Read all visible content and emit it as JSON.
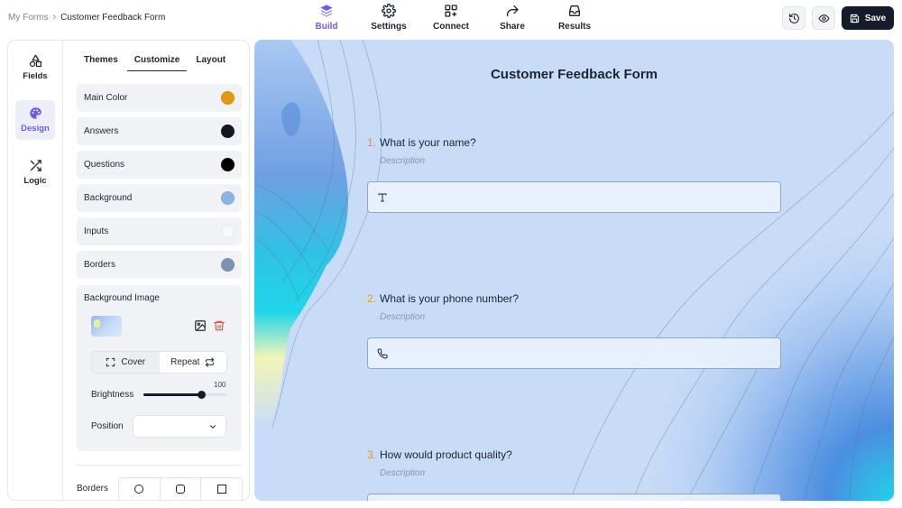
{
  "breadcrumb": {
    "root": "My Forms",
    "separator": "›",
    "current": "Customer Feedback Form"
  },
  "nav": [
    {
      "label": "Build",
      "icon": "layers-icon",
      "active": true
    },
    {
      "label": "Settings",
      "icon": "gear-icon",
      "active": false
    },
    {
      "label": "Connect",
      "icon": "integrations-icon",
      "active": false
    },
    {
      "label": "Share",
      "icon": "share-arrow-icon",
      "active": false
    },
    {
      "label": "Results",
      "icon": "inbox-icon",
      "active": false
    }
  ],
  "actions": {
    "save_label": "Save"
  },
  "rail": [
    {
      "label": "Fields",
      "icon": "shapes-icon",
      "active": false
    },
    {
      "label": "Design",
      "icon": "palette-icon",
      "active": true
    },
    {
      "label": "Logic",
      "icon": "shuffle-icon",
      "active": false
    }
  ],
  "tabs": [
    {
      "label": "Themes",
      "active": false
    },
    {
      "label": "Customize",
      "active": true
    },
    {
      "label": "Layout",
      "active": false
    }
  ],
  "colors": [
    {
      "label": "Main Color",
      "value": "#E39A0E"
    },
    {
      "label": "Answers",
      "value": "#151821"
    },
    {
      "label": "Questions",
      "value": "#000000"
    },
    {
      "label": "Background",
      "value": "#8DB3E6"
    },
    {
      "label": "Inputs",
      "value": "#F7F8FA"
    },
    {
      "label": "Borders",
      "value": "#7E93B4"
    }
  ],
  "background_image": {
    "title": "Background Image",
    "fit_options": [
      {
        "label": "Cover",
        "icon": "expand-icon",
        "selected": true
      },
      {
        "label": "Repeat",
        "icon": "repeat-icon",
        "selected": false
      }
    ],
    "brightness_label": "Brightness",
    "brightness_value": "100",
    "brightness_fraction": 0.7,
    "position_label": "Position",
    "position_value": ""
  },
  "borders": {
    "label": "Borders",
    "options": [
      "circle-icon",
      "rounded-square-icon",
      "square-icon"
    ]
  },
  "form": {
    "title": "Customer Feedback Form",
    "questions": [
      {
        "number": "1.",
        "title": "What is your name?",
        "description": "Description",
        "icon": "text-type-icon"
      },
      {
        "number": "2.",
        "title": "What is your phone number?",
        "description": "Description",
        "icon": "phone-icon"
      },
      {
        "number": "3.",
        "title": "How would product quality?",
        "description": "Description",
        "icon": ""
      }
    ]
  }
}
